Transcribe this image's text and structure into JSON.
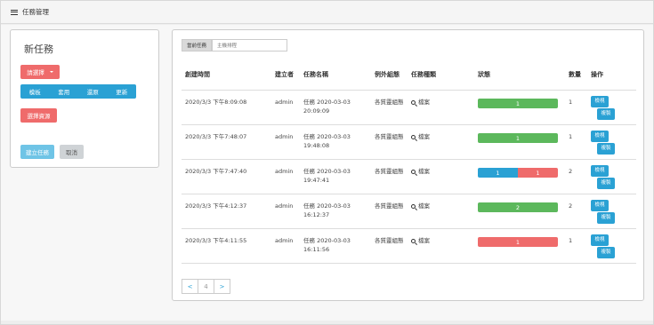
{
  "topbar": {
    "title": "任務管理",
    "icon": "menu-icon"
  },
  "left_panel": {
    "title": "新任務",
    "select_label": "請選擇",
    "action_group": [
      "模板",
      "套用",
      "還原",
      "更新"
    ],
    "select_resource_label": "選擇資源",
    "create_label": "建立任務",
    "cancel_label": "取消"
  },
  "right_panel": {
    "tabs": [
      {
        "label": "當前任務",
        "active": true
      },
      {
        "label": "主機排程",
        "active": false
      }
    ],
    "columns": [
      "創建時間",
      "建立者",
      "任務名稱",
      "例外組態",
      "任務種類",
      "狀態",
      "數量",
      "操作"
    ],
    "rows": [
      {
        "created": "2020/3/3 下午8:09:08",
        "creator": "admin",
        "name": "任務 2020-03-03 20:09:09",
        "exception": "各質靈組態",
        "kind": "檔案",
        "status": [
          {
            "value": "1",
            "color": "#5cb85c",
            "fraction": 1.0
          }
        ],
        "count": "1",
        "action1": "檢視",
        "action2": "複製"
      },
      {
        "created": "2020/3/3 下午7:48:07",
        "creator": "admin",
        "name": "任務 2020-03-03 19:48:08",
        "exception": "各質靈組態",
        "kind": "檔案",
        "status": [
          {
            "value": "1",
            "color": "#5cb85c",
            "fraction": 1.0
          }
        ],
        "count": "1",
        "action1": "檢視",
        "action2": "複製"
      },
      {
        "created": "2020/3/3 下午7:47:40",
        "creator": "admin",
        "name": "任務 2020-03-03 19:47:41",
        "exception": "各質靈組態",
        "kind": "檔案",
        "status": [
          {
            "value": "1",
            "color": "#2aa1d4",
            "fraction": 0.5
          },
          {
            "value": "1",
            "color": "#ef6b6b",
            "fraction": 0.5
          }
        ],
        "count": "2",
        "action1": "檢視",
        "action2": "複製"
      },
      {
        "created": "2020/3/3 下午4:12:37",
        "creator": "admin",
        "name": "任務 2020-03-03 16:12:37",
        "exception": "各質靈組態",
        "kind": "檔案",
        "status": [
          {
            "value": "2",
            "color": "#5cb85c",
            "fraction": 1.0
          }
        ],
        "count": "2",
        "action1": "檢視",
        "action2": "複製"
      },
      {
        "created": "2020/3/3 下午4:11:55",
        "creator": "admin",
        "name": "任務 2020-03-03 16:11:56",
        "exception": "各質靈組態",
        "kind": "檔案",
        "status": [
          {
            "value": "1",
            "color": "#ef6b6b",
            "fraction": 1.0
          }
        ],
        "count": "1",
        "action1": "檢視",
        "action2": "複製"
      }
    ],
    "pager": {
      "prev": "<",
      "page": "4",
      "next": ">"
    }
  }
}
